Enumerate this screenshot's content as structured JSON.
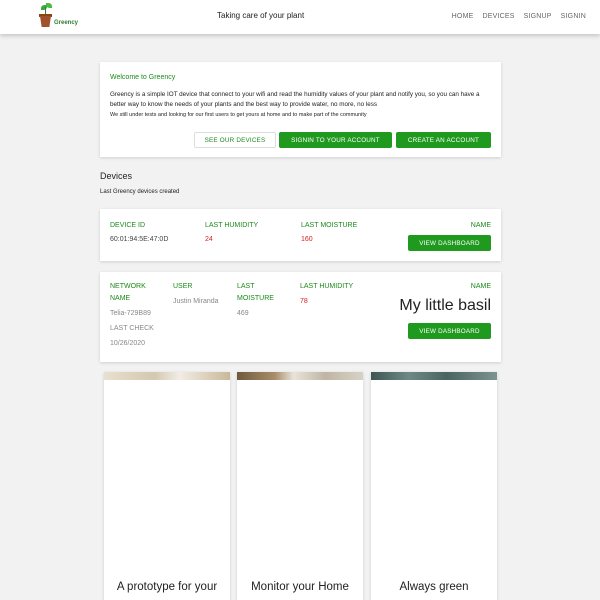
{
  "header": {
    "logo_text": "Greency",
    "tagline": "Taking care of your plant",
    "nav": [
      "HOME",
      "DEVICES",
      "SIGNUP",
      "SIGNIN"
    ]
  },
  "welcome": {
    "title": "Welcome to Greency",
    "body": "Greency is a simple IOT device that connect to your wifi and read the humidity values of your plant and notify you, so you can have a better way to know the needs of your plants and the best way to provide water, no more, no less",
    "note": "We still under tests and looking for our first users to get yours at home and to make part of the community",
    "buttons": {
      "see_devices": "SEE OUR DEVICES",
      "signin": "SIGNIN TO YOUR ACCOUNT",
      "create": "CREATE AN ACCOUNT"
    }
  },
  "devices_section": {
    "title": "Devices",
    "subtitle": "Last Greency devices created"
  },
  "device1": {
    "device_id_label": "DEVICE ID",
    "device_id": "60:01:94:5E:47:0D",
    "humidity_label": "LAST HUMIDITY",
    "humidity": "24",
    "moisture_label": "LAST MOISTURE",
    "moisture": "160",
    "name_label": "NAME",
    "button": "VIEW DASHBOARD"
  },
  "device2": {
    "network_label": "NETWORK NAME",
    "network": "Telia-729B89",
    "last_check_label": "LAST CHECK",
    "last_check": "10/26/2020",
    "user_label": "USER",
    "user": "Justin Miranda",
    "moisture_label": "LAST MOISTURE",
    "moisture": "469",
    "humidity_label": "LAST HUMIDITY",
    "humidity": "78",
    "name_label": "NAME",
    "name": "My little basil",
    "button": "VIEW DASHBOARD"
  },
  "feature_cards": [
    {
      "caption": "A prototype for your"
    },
    {
      "caption": "Monitor your Home"
    },
    {
      "caption": "Always green"
    }
  ],
  "colors": {
    "accent": "#1f9a1f",
    "label_green": "#1a8a1a",
    "alert_red": "#d61f1f"
  }
}
